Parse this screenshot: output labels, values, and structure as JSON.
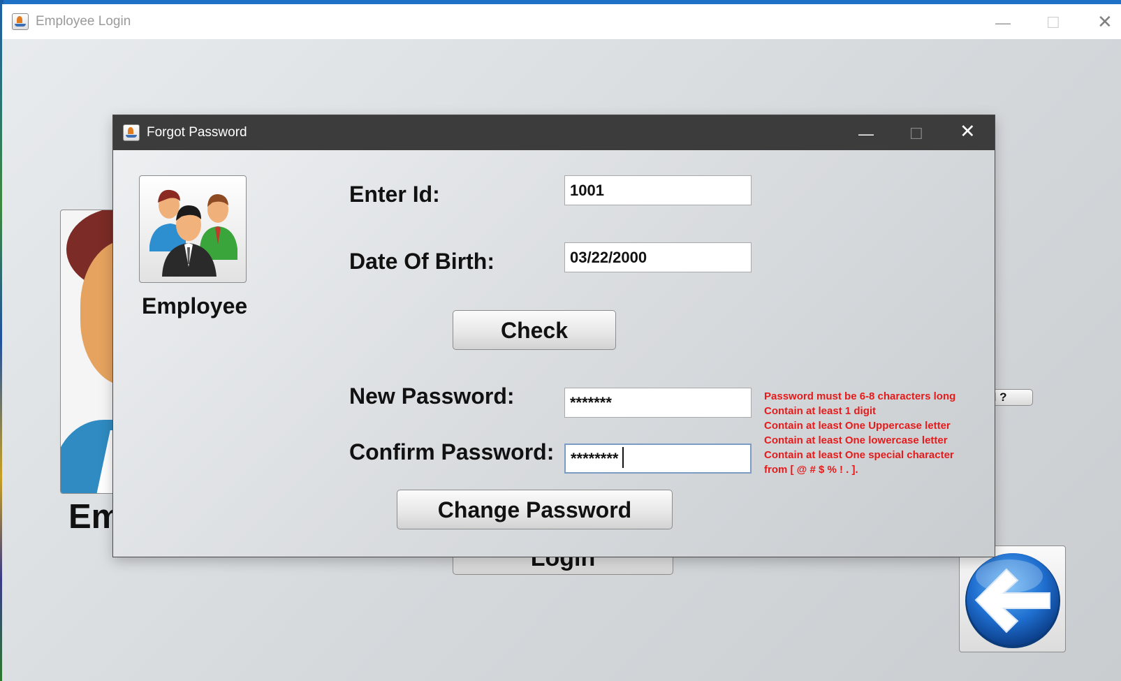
{
  "main_window": {
    "title": "Employee Login",
    "controls": {
      "minimize": "—",
      "maximize": "☐",
      "close": "✕"
    },
    "background": {
      "employee_label": "Em",
      "login_button": "Login",
      "forgot_link": "d ?"
    }
  },
  "dialog": {
    "title": "Forgot Password",
    "controls": {
      "minimize": "—",
      "maximize": "☐",
      "close": "✕"
    },
    "avatar_label": "Employee",
    "fields": {
      "id_label": "Enter Id:",
      "id_value": "1001",
      "dob_label": "Date Of Birth:",
      "dob_value": "03/22/2000",
      "new_password_label": "New Password:",
      "new_password_value": "*******",
      "confirm_password_label": "Confirm Password:",
      "confirm_password_value": "********"
    },
    "buttons": {
      "check": "Check",
      "change_password": "Change Password"
    },
    "password_rules": [
      "Password must be 6-8 characters long",
      "Contain at least 1 digit",
      "Contain at least One Uppercase letter",
      "Contain at least One lowercase letter",
      "Contain at least One special character",
      "from [ @ # $ % ! . ]."
    ]
  },
  "icons": [
    "java-app-icon",
    "employee-group-icon",
    "back-arrow-icon"
  ],
  "colors": {
    "dialog_titlebar": "#3c3c3c",
    "rule_text": "#e51b1b",
    "back_button_blue": "#1f6fd0"
  }
}
